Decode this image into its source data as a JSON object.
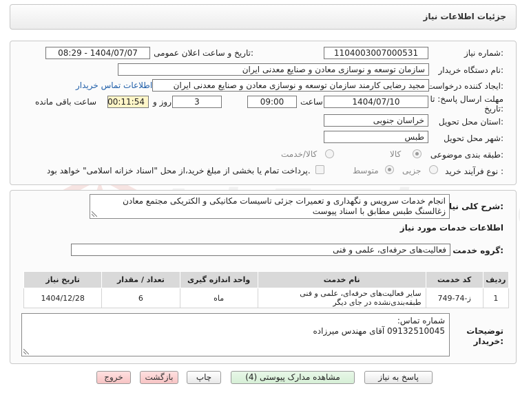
{
  "header": {
    "title": "جزئیات اطلاعات نیاز"
  },
  "form": {
    "need_number": {
      "label": "شماره نیاز:",
      "value": "1104003007000531"
    },
    "announce_datetime": {
      "label": "تاریخ و ساعت اعلان عمومی:",
      "value": "1404/07/07 - 08:29"
    },
    "buyer_org": {
      "label": "نام دستگاه خریدار:",
      "value": "سازمان توسعه و نوسازی معادن و صنایع معدنی ایران"
    },
    "requester": {
      "label": "ایجاد کننده درخواست:",
      "value": "مجید رضایی  کارمند  سازمان توسعه و نوسازی معادن و صنایع معدنی ایران",
      "contact_link": "اطلاعات تماس خریدار"
    },
    "deadline": {
      "label_line1": "مهلت ارسال پاسخ: تا",
      "label_line2": "تاریخ:",
      "date": "1404/07/10",
      "time_label": "ساعت",
      "time": "09:00",
      "days": "3",
      "days_label": "روز و",
      "remaining": "00:11:54",
      "remaining_label": "ساعت باقی مانده"
    },
    "province": {
      "label": "استان محل تحویل:",
      "value": "خراسان جنوبی"
    },
    "city": {
      "label": "شهر محل تحویل:",
      "value": "طبس"
    },
    "category": {
      "label": "طبقه بندی موضوعی:",
      "options": [
        "کالا",
        "کالا/خدمت"
      ]
    },
    "purchase_type": {
      "label": "نوع فرآیند خرید :",
      "options": [
        "جزیی",
        "متوسط"
      ],
      "note": "پرداخت تمام یا بخشی از مبلغ خرید،از محل \"اسناد خزانه اسلامی\" خواهد بود."
    }
  },
  "description": {
    "label": "شرح کلی نیاز:",
    "text": "انجام خدمات سرویس و نگهداری و تعمیرات جزئی تاسیسات مکانیکی و الکتریکی مجتمع معادن زغالسنگ طبس مطابق با اسناد پیوست"
  },
  "services": {
    "section_title": "اطلاعات خدمات مورد نیاز",
    "group_label": "گروه خدمت:",
    "group_value": "فعالیت‌های حرفه‌ای، علمی و فنی",
    "table": {
      "headers": [
        "ردیف",
        "کد خدمت",
        "نام خدمت",
        "واحد اندازه گیری",
        "تعداد / مقدار",
        "تاریخ نیاز"
      ],
      "rows": [
        [
          "1",
          "ز-74-749",
          "سایر فعالیت‌های حرفه‌ای، علمی و فنی طبقه‌بندی‌نشده در جای دیگر",
          "ماه",
          "6",
          "1404/12/28"
        ]
      ]
    }
  },
  "buyer_notes": {
    "label_line1": "توضیحات",
    "label_line2": "خریدار:",
    "line1": "شماره تماس:",
    "line2": "09132510045 آقای مهندس میرزاده"
  },
  "buttons": {
    "reply": "پاسخ به نیاز",
    "attachments": "مشاهده مدارک پیوستی (4)",
    "print": "چاپ",
    "back": "بازگشت",
    "exit": "خروج"
  },
  "watermark": {
    "text": "AriaTender.net"
  }
}
